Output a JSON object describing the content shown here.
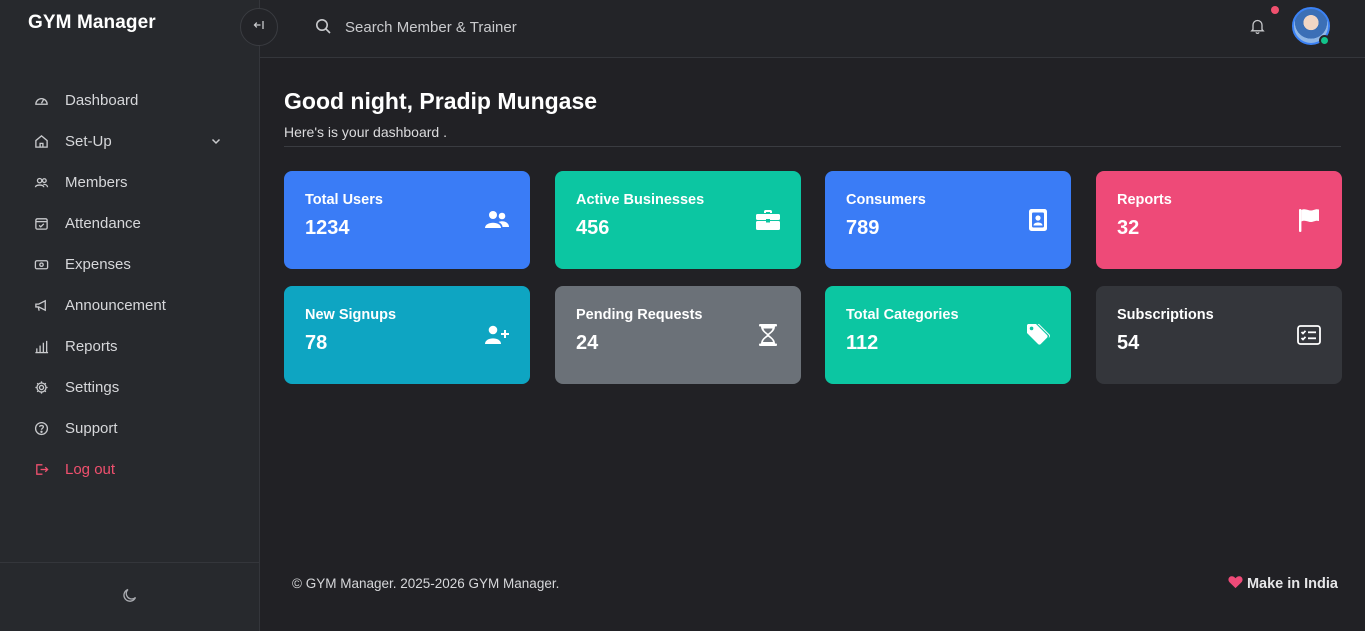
{
  "app": {
    "brand": "GYM Manager"
  },
  "sidebar": {
    "items": [
      {
        "label": "Dashboard",
        "icon": "dashboard-icon"
      },
      {
        "label": "Set-Up",
        "icon": "home-icon",
        "expandable": true
      },
      {
        "label": "Members",
        "icon": "members-icon"
      },
      {
        "label": "Attendance",
        "icon": "calendar-check-icon"
      },
      {
        "label": "Expenses",
        "icon": "money-icon"
      },
      {
        "label": "Announcement",
        "icon": "megaphone-icon"
      },
      {
        "label": "Reports",
        "icon": "bar-chart-icon"
      },
      {
        "label": "Settings",
        "icon": "gear-icon"
      },
      {
        "label": "Support",
        "icon": "help-icon"
      },
      {
        "label": "Log out",
        "icon": "logout-icon",
        "color": "#f0506e"
      }
    ],
    "theme_toggle_icon": "moon-icon"
  },
  "topbar": {
    "search_placeholder": "Search Member & Trainer",
    "notification_dot_color": "#f0506e",
    "status_color": "#12c48b"
  },
  "main": {
    "greeting": "Good night, Pradip Mungase",
    "subtitle": "Here's is your dashboard ."
  },
  "cards": [
    {
      "label": "Total Users",
      "value": "1234",
      "icon": "users-icon",
      "color": "#3a7cf6"
    },
    {
      "label": "Active Businesses",
      "value": "456",
      "icon": "briefcase-icon",
      "color": "#0cc6a2"
    },
    {
      "label": "Consumers",
      "value": "789",
      "icon": "id-badge-icon",
      "color": "#3a7cf6"
    },
    {
      "label": "Reports",
      "value": "32",
      "icon": "flag-icon",
      "color": "#ee4a78"
    },
    {
      "label": "New Signups",
      "value": "78",
      "icon": "user-plus-icon",
      "color": "#0ea5c2"
    },
    {
      "label": "Pending Requests",
      "value": "24",
      "icon": "hourglass-icon",
      "color": "#6b7178"
    },
    {
      "label": "Total Categories",
      "value": "112",
      "icon": "tag-icon",
      "color": "#0cc6a2"
    },
    {
      "label": "Subscriptions",
      "value": "54",
      "icon": "checklist-icon",
      "color": "#34363b"
    }
  ],
  "footer": {
    "copyright": "© GYM Manager. 2025-2026 GYM Manager.",
    "made_in": "Make in India",
    "heart_color": "#ee4a78"
  }
}
